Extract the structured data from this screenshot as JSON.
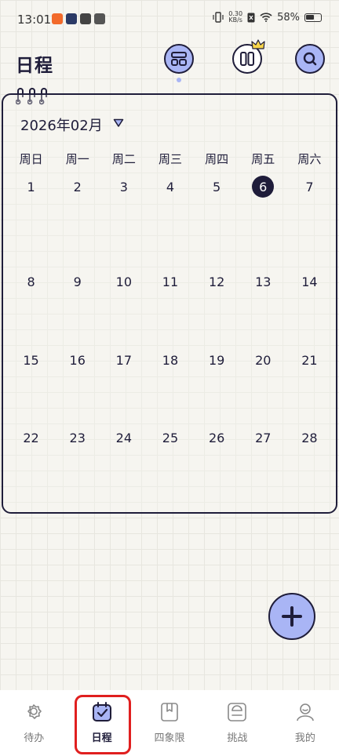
{
  "status_bar": {
    "time": "13:01",
    "net_speed_value": "0.30",
    "net_speed_unit": "KB/s",
    "battery": "58%"
  },
  "header": {
    "title": "日程"
  },
  "calendar": {
    "month_label": "2026年02月",
    "weekdays": [
      "周日",
      "周一",
      "周二",
      "周三",
      "周四",
      "周五",
      "周六"
    ],
    "weeks": [
      [
        "1",
        "2",
        "3",
        "4",
        "5",
        "6",
        "7"
      ],
      [
        "8",
        "9",
        "10",
        "11",
        "12",
        "13",
        "14"
      ],
      [
        "15",
        "16",
        "17",
        "18",
        "19",
        "20",
        "21"
      ],
      [
        "22",
        "23",
        "24",
        "25",
        "26",
        "27",
        "28"
      ]
    ],
    "today": "6"
  },
  "bottom_nav": {
    "items": [
      {
        "label": "待办",
        "icon": "gear-icon"
      },
      {
        "label": "日程",
        "icon": "calendar-check-icon"
      },
      {
        "label": "四象限",
        "icon": "book-icon"
      },
      {
        "label": "挑战",
        "icon": "scale-icon"
      },
      {
        "label": "我的",
        "icon": "user-icon"
      }
    ],
    "active_index": 1
  },
  "colors": {
    "accent": "#a9b5f5",
    "ink": "#1f1d3a",
    "highlight": "#e01f1f"
  }
}
